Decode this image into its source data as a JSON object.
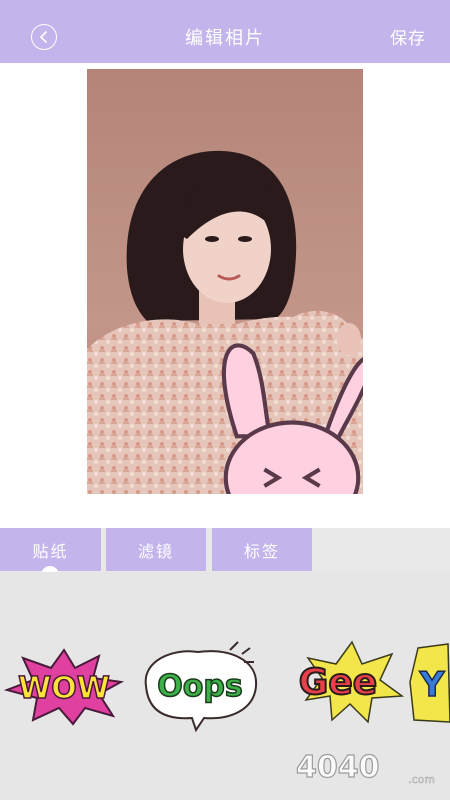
{
  "header": {
    "title": "编辑相片",
    "save_label": "保存",
    "back_icon": "chevron-left-icon",
    "background": "#c4b4ec"
  },
  "tabs": [
    {
      "label": "贴纸",
      "selected": true
    },
    {
      "label": "滤镜",
      "selected": false
    },
    {
      "label": "标签",
      "selected": false
    }
  ],
  "stickers": [
    {
      "text": "WOW",
      "icon": "wow-sticker"
    },
    {
      "text": "Oops",
      "icon": "oops-sticker"
    },
    {
      "text": "Gee",
      "icon": "gee-sticker"
    },
    {
      "text": "Y",
      "icon": "partial-sticker"
    }
  ],
  "watermark": {
    "text": "4040",
    "suffix": ".com"
  },
  "colors": {
    "accent": "#c4b4ec",
    "panel": "#e6e6e6"
  }
}
